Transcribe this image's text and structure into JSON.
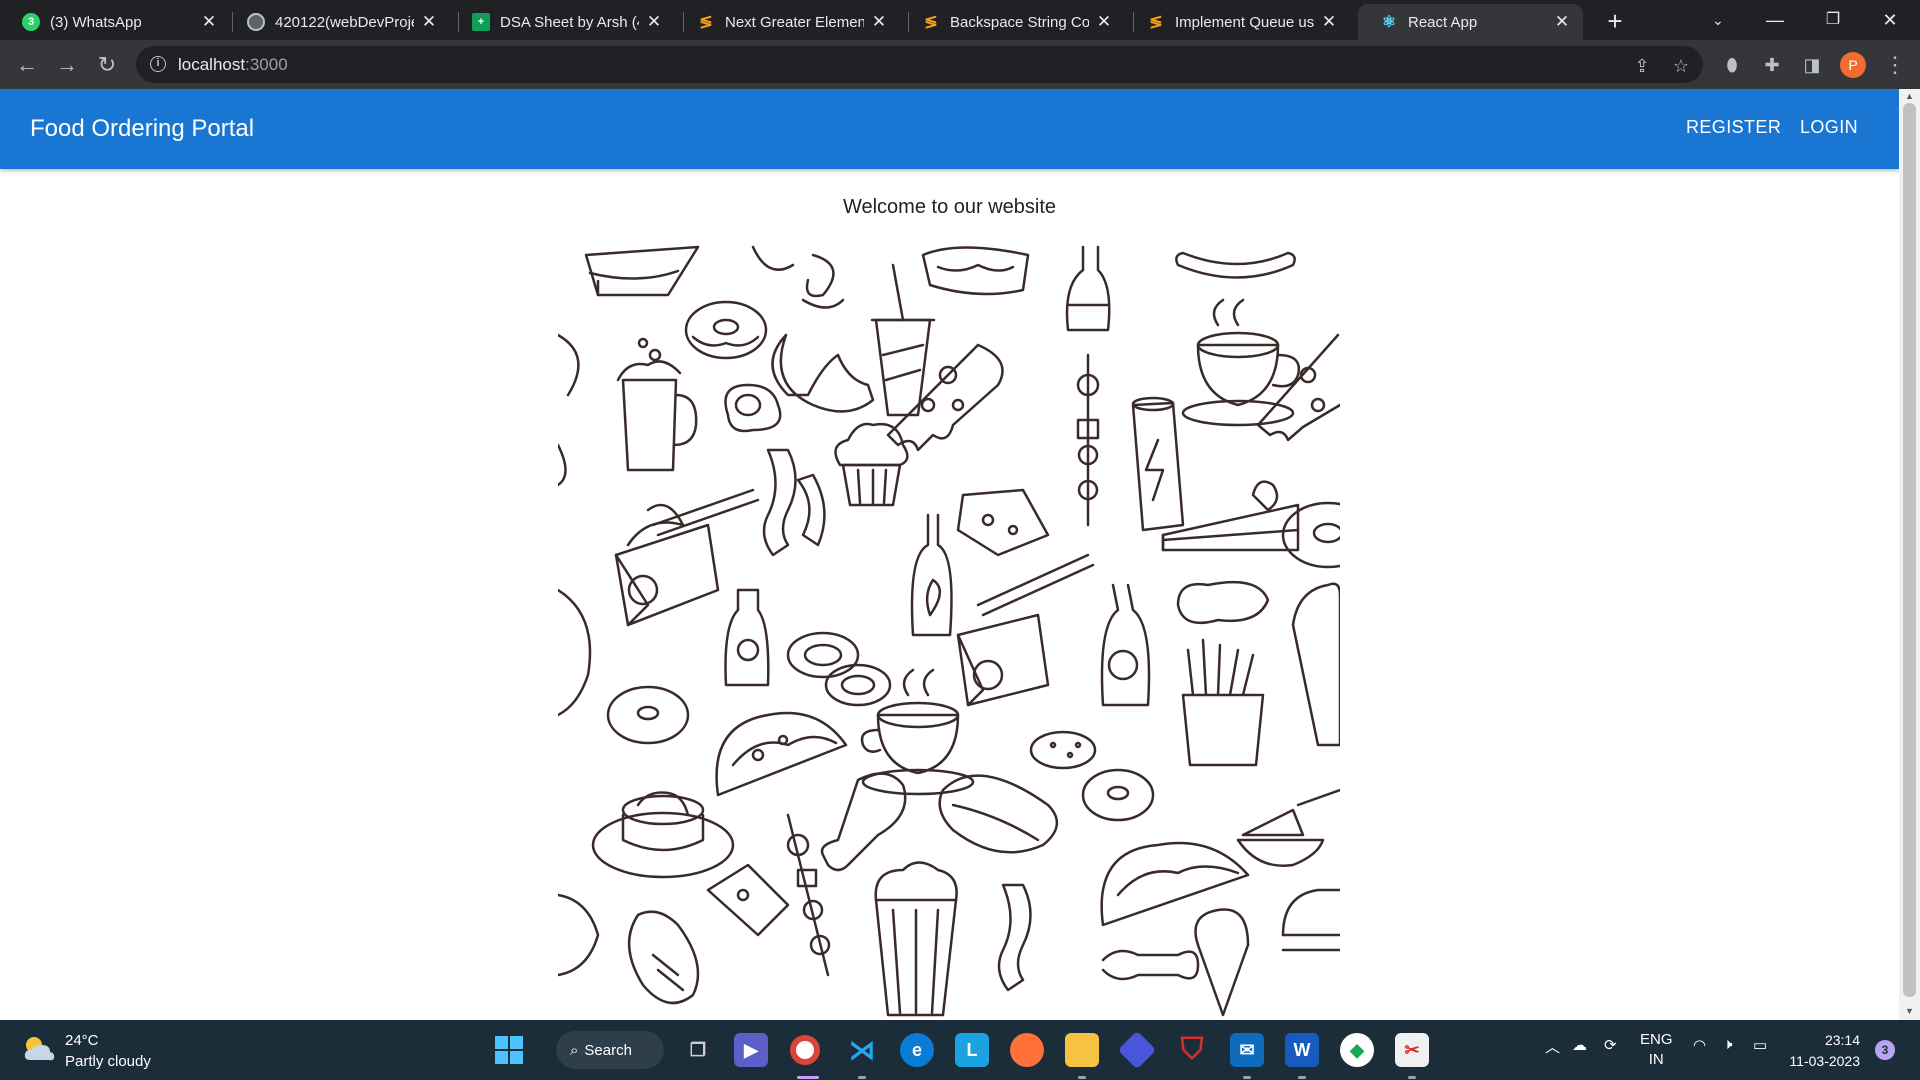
{
  "browser": {
    "tabs": [
      {
        "title": "(3) WhatsApp",
        "icon": "whatsapp-icon",
        "badge": "3",
        "color": "#25d366"
      },
      {
        "title": "420122(webDevProje",
        "icon": "globe-icon",
        "color": "#9aa0a6"
      },
      {
        "title": "DSA Sheet by Arsh (4",
        "icon": "sheets-icon",
        "color": "#0f9d58"
      },
      {
        "title": "Next Greater Element",
        "icon": "leetcode-icon",
        "color": "#f89f1b"
      },
      {
        "title": "Backspace String Con",
        "icon": "leetcode-icon",
        "color": "#f89f1b"
      },
      {
        "title": "Implement Queue usi",
        "icon": "leetcode-icon",
        "color": "#f89f1b"
      },
      {
        "title": "React App",
        "icon": "react-icon",
        "color": "#61dafb",
        "active": true
      }
    ],
    "url_host": "localhost",
    "url_port": ":3000",
    "profile_initial": "P"
  },
  "app": {
    "brand": "Food Ordering Portal",
    "nav": {
      "register": "REGISTER",
      "login": "LOGIN"
    },
    "accent": "#1976d2",
    "welcome": "Welcome to our website"
  },
  "taskbar": {
    "weather": {
      "temp": "24°C",
      "desc": "Partly cloudy"
    },
    "search_label": "Search",
    "lang": {
      "line1": "ENG",
      "line2": "IN"
    },
    "clock": {
      "time": "23:14",
      "date": "11-03-2023"
    },
    "notifications": "3"
  }
}
